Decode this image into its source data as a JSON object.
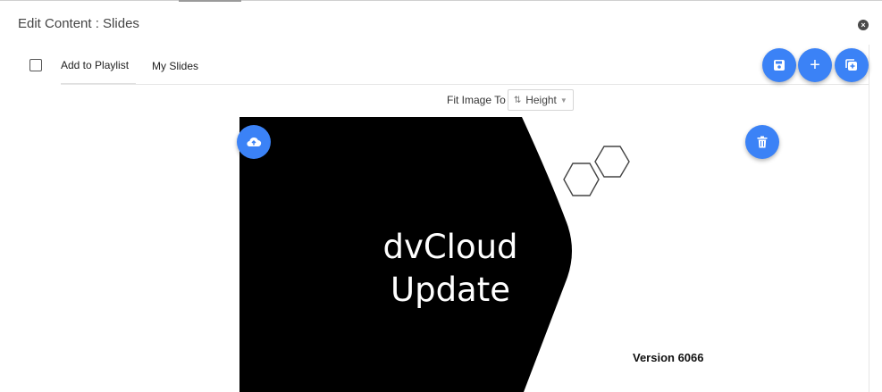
{
  "header": {
    "title": "Edit Content : Slides"
  },
  "toolbar": {
    "add_to_playlist_label": "Add to Playlist",
    "my_slides_label": "My Slides",
    "add_symbol": "+"
  },
  "fit": {
    "label": "Fit Image To",
    "selected": "Height"
  },
  "slide": {
    "title_line1": "dvCloud",
    "title_line2": "Update",
    "version": "Version 6066"
  },
  "icons": [
    "close-icon",
    "save-icon",
    "plus-icon",
    "copy-icon",
    "swap-vertical-icon",
    "chevron-down-icon",
    "cloud-upload-icon",
    "trash-icon",
    "hexagon-icon"
  ],
  "colors": {
    "accent": "#3b82f6",
    "slide_background": "#000000"
  }
}
